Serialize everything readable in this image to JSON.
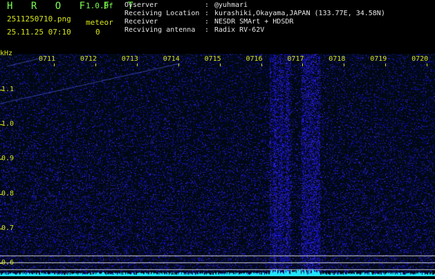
{
  "header": {
    "app_title": "H R O F F T",
    "version": "1.0.0f",
    "filename": "2511250710.png",
    "meteor_label": "meteor",
    "datetime": "25.11.25 07:10",
    "meteor_count": "0",
    "observer_label": "Ovserver",
    "observer_value": "@yuhmari",
    "location_label": "Receiving Location",
    "location_value": "kurashiki,Okayama,JAPAN (133.77E, 34.58N)",
    "receiver_label": "Receiver",
    "receiver_value": "NESDR SMArt + HDSDR",
    "antenna_label": "Recviving antenna",
    "antenna_value": "Radix RV-62V",
    "separator": ":"
  },
  "chart_data": {
    "type": "heatmap",
    "ylabel": "kHz",
    "y_ticks": [
      "1.1",
      "1.0",
      "0.9",
      "0.8",
      "0.7",
      "0.6"
    ],
    "y_values": [
      1.1,
      1.0,
      0.9,
      0.8,
      0.7,
      0.6
    ],
    "x_ticks": [
      "0711",
      "0712",
      "0713",
      "0714",
      "0715",
      "0716",
      "0717",
      "0718",
      "0719",
      "0720"
    ],
    "colors": {
      "background": "#000814",
      "noise": "#1a2cb0",
      "text": "#d8e61c",
      "baseline": "#22e6ff"
    }
  }
}
